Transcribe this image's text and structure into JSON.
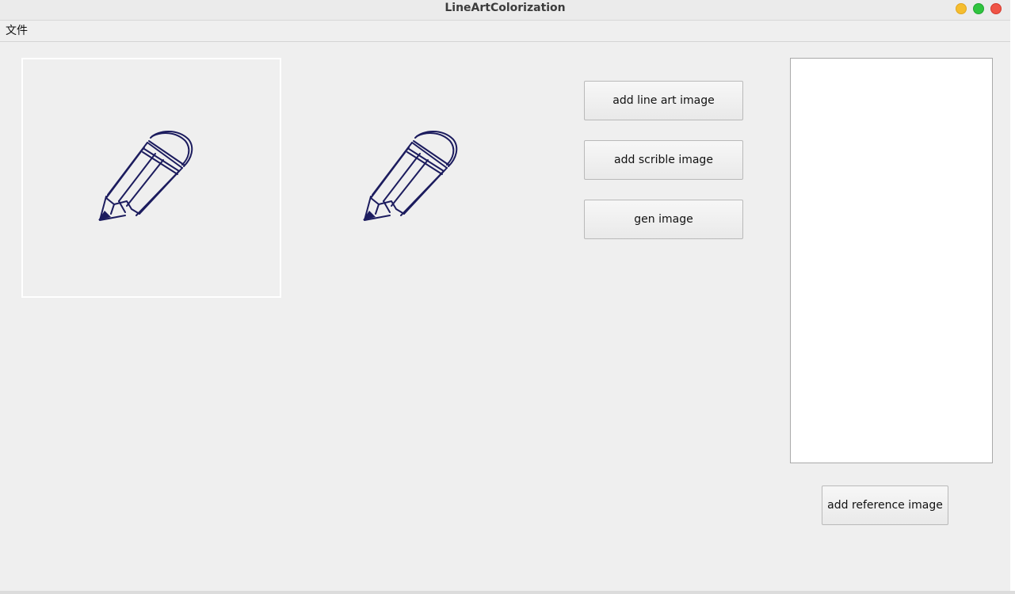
{
  "window": {
    "title": "LineArtColorization"
  },
  "menubar": {
    "items": [
      {
        "label": "文件"
      }
    ]
  },
  "canvas": {
    "line_art_placeholder_icon": "pencil-icon",
    "scribble_placeholder_icon": "pencil-icon",
    "icon_color": "#1c1c5e"
  },
  "controls": {
    "add_line_art_label": "add line art image",
    "add_scribble_label": "add scrible image",
    "gen_image_label": "gen image",
    "add_reference_label": "add reference image"
  },
  "colors": {
    "window_bg": "#efefef",
    "button_border": "#b9b9b9",
    "panel_bg": "#ffffff"
  }
}
